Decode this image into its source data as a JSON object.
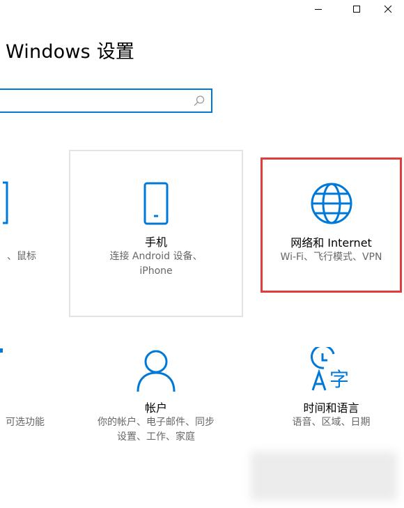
{
  "window": {
    "title": "Windows 设置",
    "minimize_glyph": "—",
    "maximize_glyph": "☐",
    "close_glyph": "✕"
  },
  "search": {
    "value": "",
    "placeholder": ""
  },
  "tiles": [
    {
      "icon": "device-icon",
      "title": "",
      "desc": [
        "、鼠标"
      ]
    },
    {
      "icon": "phone-icon",
      "title": "手机",
      "desc": [
        "连接 Android 设备、",
        "iPhone"
      ]
    },
    {
      "icon": "globe-icon",
      "title": "网络和 Internet",
      "desc": [
        "Wi-Fi、飞行模式、VPN"
      ],
      "highlighted": true
    },
    {
      "icon": "apps-icon",
      "title": "",
      "desc": [
        "可选功能"
      ]
    },
    {
      "icon": "person-icon",
      "title": "帐户",
      "desc": [
        "你的帐户、电子邮件、同步",
        "设置、工作、家庭"
      ]
    },
    {
      "icon": "time-language-icon",
      "title": "时间和语言",
      "desc": [
        "语音、区域、日期"
      ]
    }
  ],
  "colors": {
    "accent": "#0078d7",
    "highlight_border": "#e03c3c",
    "tile_border": "#e3e3e3",
    "desc_text": "#666666"
  }
}
